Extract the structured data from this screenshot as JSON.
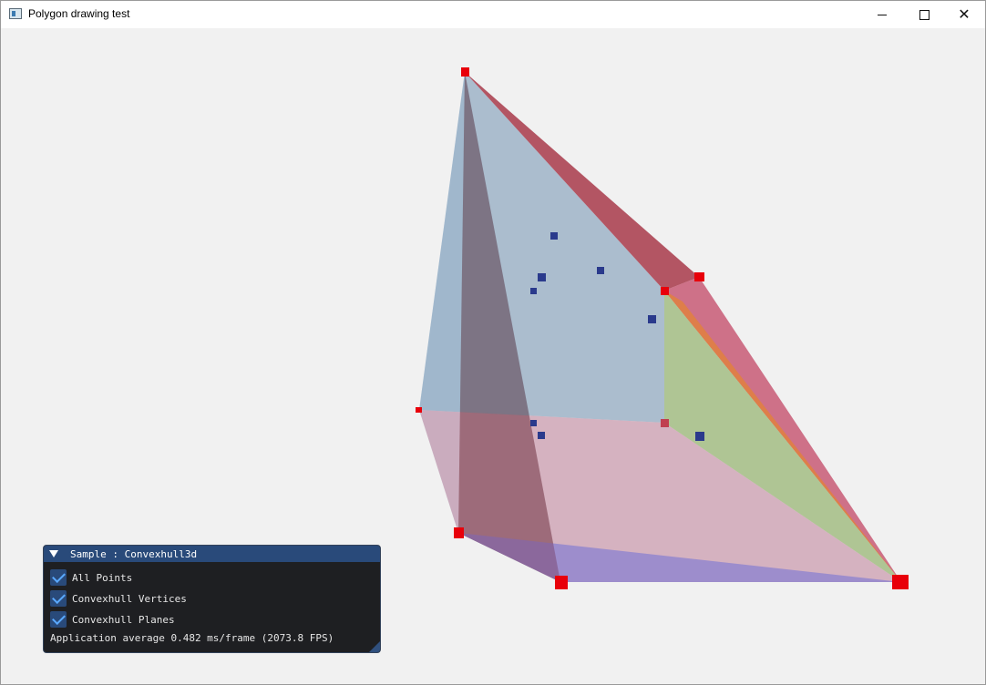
{
  "window": {
    "title": "Polygon drawing test",
    "buttons": {
      "minimize": "minimize",
      "maximize": "maximize",
      "close": "close"
    }
  },
  "panel": {
    "title": "Sample : Convexhull3d",
    "checkboxes": [
      {
        "label": "All Points",
        "checked": true
      },
      {
        "label": "Convexhull Vertices",
        "checked": true
      },
      {
        "label": "Convexhull Planes",
        "checked": true
      }
    ],
    "status": "Application average 0.482 ms/frame (2073.8 FPS)"
  },
  "colors": {
    "background": "#f1f1f1",
    "hull_vertex": "#e8000a",
    "interior_point": "#2a3a8c",
    "panel_header": "#294a7a",
    "panel_body": "#1e1f22"
  },
  "icons": {
    "app": "app-window-icon",
    "collapse": "triangle-down-icon",
    "check": "checkmark-icon",
    "minimize": "minimize-icon",
    "maximize": "maximize-icon",
    "close": "close-icon"
  }
}
